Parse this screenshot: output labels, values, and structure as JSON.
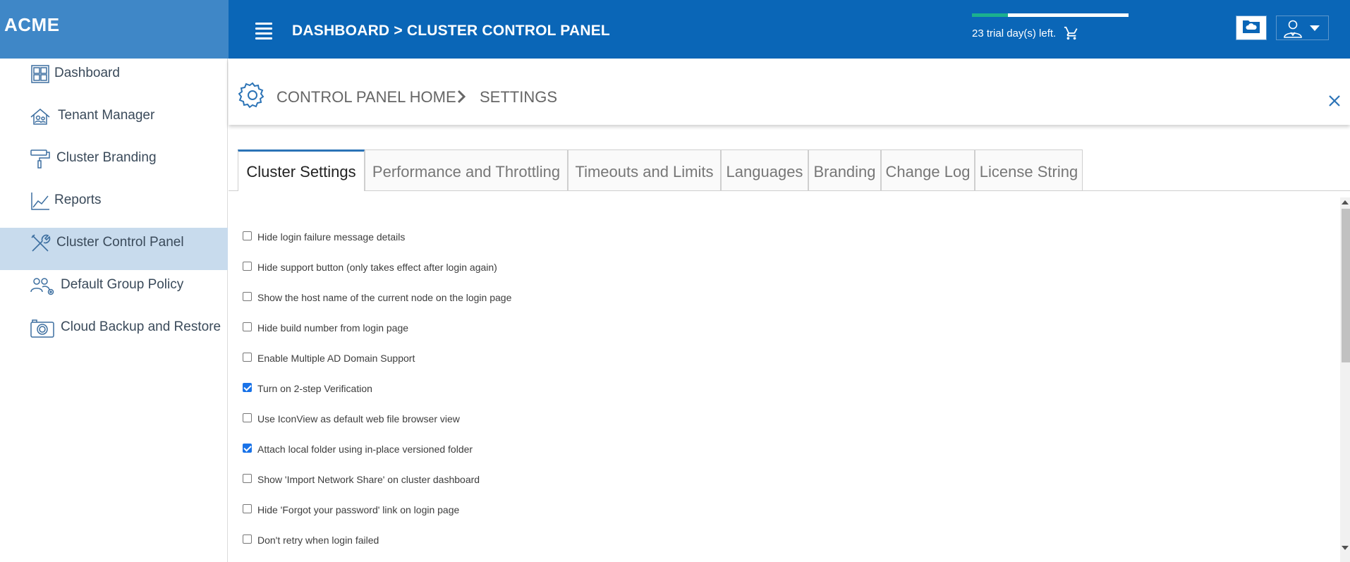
{
  "app": {
    "logo": "ACME"
  },
  "sidebar": {
    "items": [
      {
        "label": "Dashboard",
        "icon": "dashboard-grid-icon",
        "active": false
      },
      {
        "label": "Tenant Manager",
        "icon": "tenant-house-icon",
        "active": false
      },
      {
        "label": "Cluster Branding",
        "icon": "paint-roller-icon",
        "active": false
      },
      {
        "label": "Reports",
        "icon": "line-chart-icon",
        "active": false
      },
      {
        "label": "Cluster Control Panel",
        "icon": "tools-icon",
        "active": true
      },
      {
        "label": "Default Group Policy",
        "icon": "group-settings-icon",
        "active": false
      },
      {
        "label": "Cloud Backup and Restore",
        "icon": "camera-icon",
        "active": false
      }
    ]
  },
  "header": {
    "path": "DASHBOARD > CLUSTER CONTROL PANEL",
    "trial_text": "23 trial day(s) left.",
    "trial_progress": 0.23,
    "cloud_button_icon": "cloud-folder-icon",
    "user_button_icon": "user-icon"
  },
  "breadcrumb": {
    "home": "CONTROL PANEL HOME",
    "current": "SETTINGS"
  },
  "tabs": [
    {
      "label": "Cluster Settings",
      "active": true
    },
    {
      "label": "Performance and Throttling",
      "active": false
    },
    {
      "label": "Timeouts and Limits",
      "active": false
    },
    {
      "label": "Languages",
      "active": false
    },
    {
      "label": "Branding",
      "active": false
    },
    {
      "label": "Change Log",
      "active": false
    },
    {
      "label": "License String",
      "active": false
    }
  ],
  "settings": [
    {
      "label": "Hide login failure message details",
      "checked": false
    },
    {
      "label": "Hide support button (only takes effect after login again)",
      "checked": false
    },
    {
      "label": "Show the host name of the current node on the login page",
      "checked": false
    },
    {
      "label": "Hide build number from login page",
      "checked": false
    },
    {
      "label": "Enable Multiple AD Domain Support",
      "checked": false
    },
    {
      "label": "Turn on 2-step Verification",
      "checked": true
    },
    {
      "label": "Use IconView as default web file browser view",
      "checked": false
    },
    {
      "label": "Attach local folder using in-place versioned folder",
      "checked": true
    },
    {
      "label": "Show 'Import Network Share' on cluster dashboard",
      "checked": false
    },
    {
      "label": "Hide 'Forgot your password' link on login page",
      "checked": false
    },
    {
      "label": "Don't retry when login failed",
      "checked": false
    }
  ],
  "colors": {
    "topbar": "#0a66b7",
    "logo_bg": "#3f87c7",
    "active_nav": "#c8dbed",
    "accent": "#1bb08f"
  }
}
